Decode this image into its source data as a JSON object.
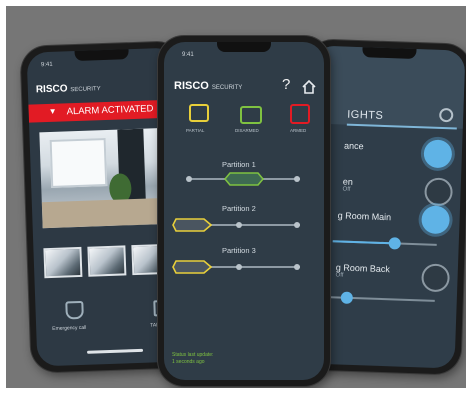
{
  "colors": {
    "backdrop": "#767676",
    "alarm_red": "#e21b24",
    "screen_bg": "#2f3c47",
    "accent_green": "#7fc241",
    "accent_yellow": "#e8cf3a",
    "accent_blue": "#5fb3e6"
  },
  "left_phone": {
    "status_time": "9:41",
    "brand_word": "RISCO",
    "brand_sub": "SECURITY",
    "alarm_banner": "ALARM ACTIVATED",
    "shortcuts": [
      {
        "label": "Emergency call",
        "icon": "phone-shield-icon"
      },
      {
        "label": "TAKE PIC",
        "icon": "camera-icon"
      }
    ]
  },
  "center_phone": {
    "status_time": "9:41",
    "brand_word": "RISCO",
    "brand_sub": "SECURITY",
    "header_icons": [
      "help-icon",
      "home-icon"
    ],
    "modes": [
      {
        "label": "PARTIAL",
        "color": "#e8cf3a",
        "icon": "lock-partial-icon"
      },
      {
        "label": "DISARMED",
        "color": "#7fc241",
        "icon": "unlock-icon"
      },
      {
        "label": "ARMED",
        "color": "#e21b24",
        "icon": "lock-icon"
      }
    ],
    "partitions": [
      {
        "name": "Partition 1",
        "state": "disarmed"
      },
      {
        "name": "Partition 2",
        "state": "partial"
      },
      {
        "name": "Partition 3",
        "state": "partial"
      }
    ],
    "footer_line1": "Status last update:",
    "footer_line2": "1 seconds ago"
  },
  "right_phone": {
    "title": "IGHTS",
    "settings_icon": "gear-icon",
    "rooms": [
      {
        "label": "ance",
        "sub": "",
        "bulb": "on"
      },
      {
        "label": "en",
        "sub": "Off",
        "bulb": "off"
      },
      {
        "label": "g Room Main",
        "sub": "",
        "bulb": "on",
        "dimmer": 0.6
      },
      {
        "label": "g Room Back",
        "sub": "Off",
        "bulb": "off",
        "dimmer": 0.15
      }
    ]
  }
}
